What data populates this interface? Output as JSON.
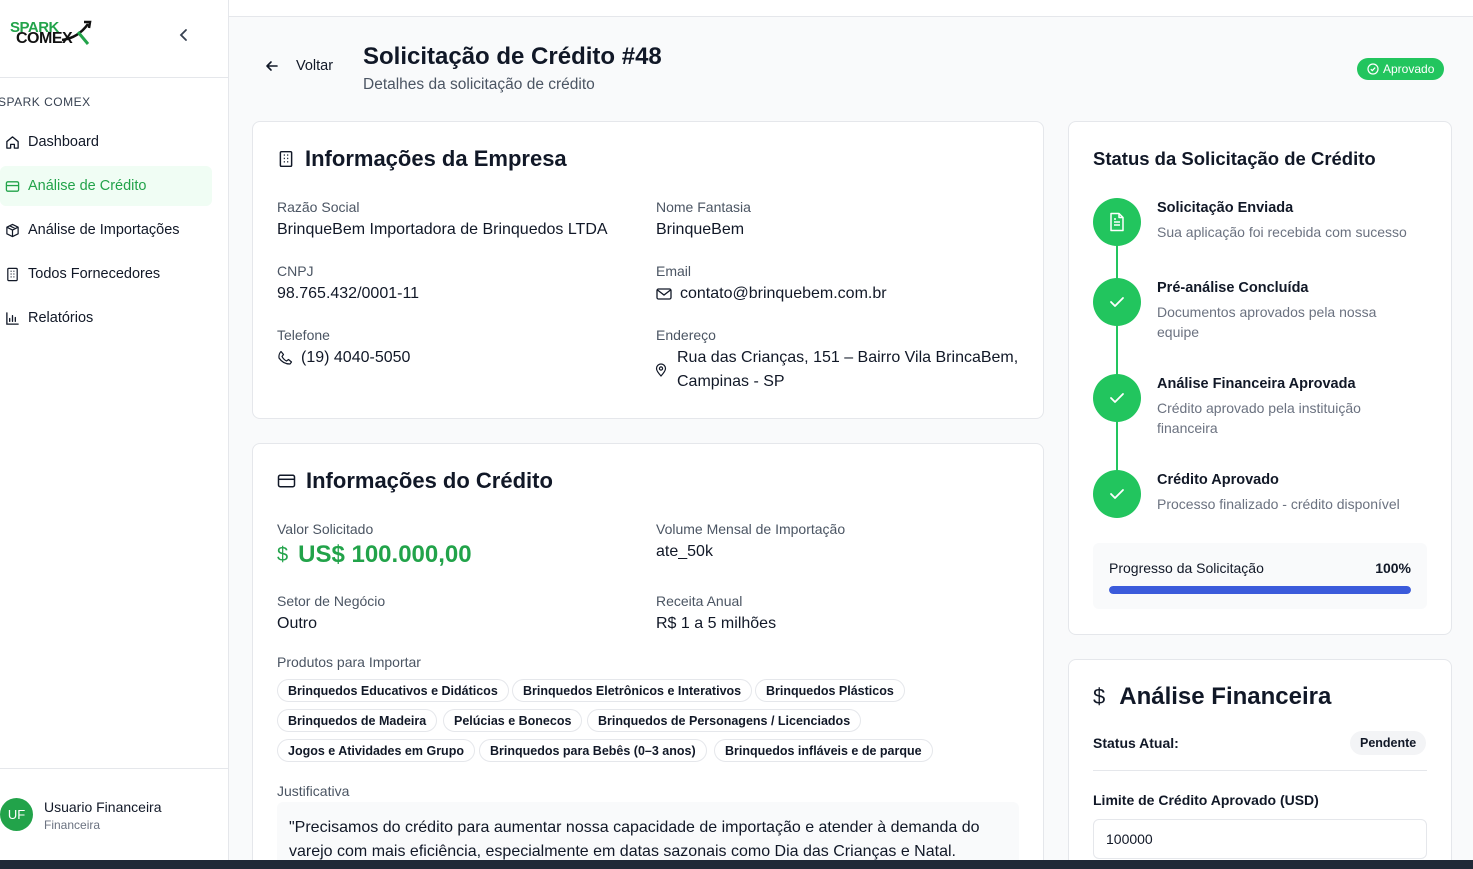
{
  "brand": {
    "line1": "SPARK",
    "line2": "COMEX"
  },
  "sidebar": {
    "section_label": "SPARK COMEX",
    "items": [
      {
        "label": "Dashboard",
        "icon": "home-icon"
      },
      {
        "label": "Análise de Crédito",
        "icon": "credit-card-icon",
        "active": true
      },
      {
        "label": "Análise de Importações",
        "icon": "package-icon"
      },
      {
        "label": "Todos Fornecedores",
        "icon": "building-icon"
      },
      {
        "label": "Relatórios",
        "icon": "bar-chart-icon"
      }
    ],
    "user": {
      "initials": "UF",
      "name": "Usuario Financeira",
      "role": "Financeira"
    }
  },
  "header": {
    "back_label": "Voltar",
    "title": "Solicitação de Crédito #48",
    "subtitle": "Detalhes da solicitação de crédito",
    "status": "Aprovado"
  },
  "company": {
    "title": "Informações da Empresa",
    "razao_label": "Razão Social",
    "razao_value": "BrinqueBem Importadora de Brinquedos LTDA",
    "fantasia_label": "Nome Fantasia",
    "fantasia_value": "BrinqueBem",
    "cnpj_label": "CNPJ",
    "cnpj_value": "98.765.432/0001-11",
    "email_label": "Email",
    "email_value": "contato@brinquebem.com.br",
    "phone_label": "Telefone",
    "phone_value": "(19) 4040-5050",
    "address_label": "Endereço",
    "address_value": "Rua das Crianças, 151 – Bairro Vila BrincaBem, Campinas - SP"
  },
  "credit": {
    "title": "Informações do Crédito",
    "valor_label": "Valor Solicitado",
    "valor_symbol": "$",
    "valor_value": "US$ 100.000,00",
    "volume_label": "Volume Mensal de Importação",
    "volume_value": "ate_50k",
    "setor_label": "Setor de Negócio",
    "setor_value": "Outro",
    "receita_label": "Receita Anual",
    "receita_value": "R$ 1 a 5 milhões",
    "produtos_label": "Produtos para Importar",
    "produtos": [
      "Brinquedos Educativos e Didáticos",
      "Brinquedos Eletrônicos e Interativos",
      "Brinquedos Plásticos",
      "Brinquedos de Madeira",
      "Pelúcias e Bonecos",
      "Brinquedos de Personagens / Licenciados",
      "Jogos e Atividades em Grupo",
      "Brinquedos para Bebês (0–3 anos)",
      "Brinquedos infláveis e de parque"
    ],
    "justificativa_label": "Justificativa",
    "justificativa_value": "\"Precisamos do crédito para aumentar nossa capacidade de importação e atender à demanda do varejo com mais eficiência, especialmente em datas sazonais como Dia das Crianças e Natal."
  },
  "status_card": {
    "title": "Status da Solicitação de Crédito",
    "steps": [
      {
        "title": "Solicitação Enviada",
        "desc": "Sua aplicação foi recebida com sucesso",
        "icon": "document-icon"
      },
      {
        "title": "Pré-análise Concluída",
        "desc": "Documentos aprovados pela nossa equipe",
        "icon": "check-icon"
      },
      {
        "title": "Análise Financeira Aprovada",
        "desc": "Crédito aprovado pela instituição financeira",
        "icon": "check-icon"
      },
      {
        "title": "Crédito Aprovado",
        "desc": "Processo finalizado - crédito disponível",
        "icon": "check-icon"
      }
    ],
    "progress_label": "Progresso da Solicitação",
    "progress_text": "100%",
    "progress_value": 1.0
  },
  "financial": {
    "symbol": "$",
    "title": "Análise Financeira",
    "status_label": "Status Atual:",
    "status_value": "Pendente",
    "limit_label": "Limite de Crédito Aprovado (USD)",
    "limit_value": "100000"
  },
  "colors": {
    "accent_green": "#22a34a",
    "success": "#22c55e",
    "progress": "#3b5bdb"
  }
}
